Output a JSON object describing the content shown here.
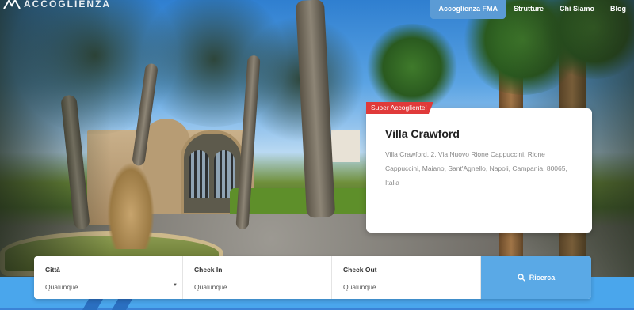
{
  "header": {
    "logo_text": "ACCOGLIENZA",
    "nav": [
      "Accoglienza FMA",
      "Strutture",
      "Chi Siamo",
      "Blog"
    ],
    "active_nav": "Accoglienza FMA"
  },
  "card": {
    "badge": "Super Accogliente!",
    "title": "Villa Crawford",
    "address": "Villa Crawford, 2, Via Nuovo Rione Cappuccini, Rione Cappuccini, Maiano, Sant'Agnello, Napoli, Campania, 80065, Italia"
  },
  "search": {
    "city_label": "Città",
    "city_value": "Qualunque",
    "checkin_label": "Check In",
    "checkin_value": "Qualunque",
    "checkout_label": "Check Out",
    "checkout_value": "Qualunque",
    "button_label": "Ricerca"
  },
  "colors": {
    "nav_active": "#5b9bd5",
    "badge": "#e03a3a",
    "search_button": "#5aa9e6",
    "band": "#4aa6ec"
  },
  "icons": [
    "logo-mark-icon",
    "search-icon",
    "dropdown-caret-icon"
  ]
}
